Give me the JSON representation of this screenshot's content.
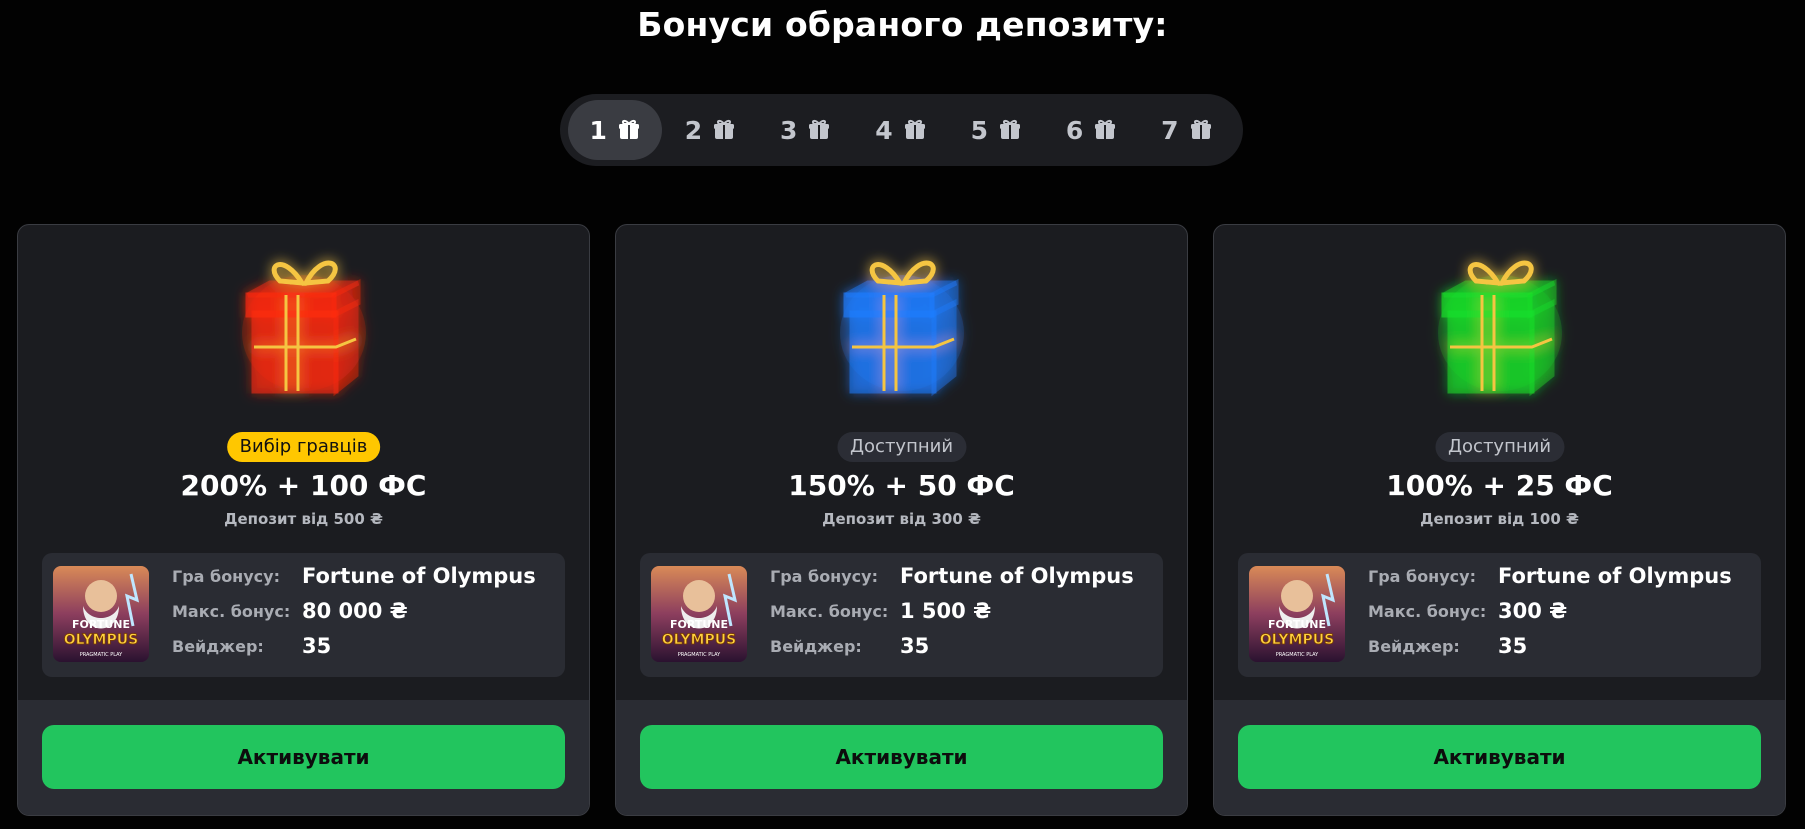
{
  "title": "Бонуси обраного депозиту:",
  "tabs": [
    {
      "label": "1",
      "icon": "gift-icon",
      "active": true
    },
    {
      "label": "2",
      "icon": "gift-icon",
      "active": false
    },
    {
      "label": "3",
      "icon": "gift-icon",
      "active": false
    },
    {
      "label": "4",
      "icon": "gift-icon",
      "active": false
    },
    {
      "label": "5",
      "icon": "gift-icon",
      "active": false
    },
    {
      "label": "6",
      "icon": "gift-icon",
      "active": false
    },
    {
      "label": "7",
      "icon": "gift-icon",
      "active": false
    }
  ],
  "labels": {
    "game": "Гра бонусу:",
    "max_bonus": "Макс. бонус:",
    "wager": "Вейджер:"
  },
  "game_thumbnail": {
    "brand": "FORTUNE",
    "subtitle": "OLYMPUS",
    "provider": "PRAGMATIC PLAY"
  },
  "cards": [
    {
      "gift_color": "#ff2a10",
      "gift_icon": "red-gift-icon",
      "badge": "Вибір гравців",
      "badge_style": "popular",
      "headline": "200% + 100 ФС",
      "deposit": "Депозит від 500 ₴",
      "game": "Fortune of Olympus",
      "max_bonus": "80 000 ₴",
      "wager": "35",
      "button": "Активувати"
    },
    {
      "gift_color": "#1f7dff",
      "gift_icon": "blue-gift-icon",
      "badge": "Доступний",
      "badge_style": "available",
      "headline": "150% + 50 ФС",
      "deposit": "Депозит від 300 ₴",
      "game": "Fortune of Olympus",
      "max_bonus": "1 500 ₴",
      "wager": "35",
      "button": "Активувати"
    },
    {
      "gift_color": "#19e02a",
      "gift_icon": "green-gift-icon",
      "badge": "Доступний",
      "badge_style": "available",
      "headline": "100% + 25 ФС",
      "deposit": "Депозит від 100 ₴",
      "game": "Fortune of Olympus",
      "max_bonus": "300 ₴",
      "wager": "35",
      "button": "Активувати"
    }
  ],
  "colors": {
    "background": "#020202",
    "card": "#1b1c20",
    "panel": "#2a2c33",
    "accent_green": "#22c55e",
    "badge_yellow": "#ffc700",
    "ribbon_gold": "#f5c542"
  }
}
